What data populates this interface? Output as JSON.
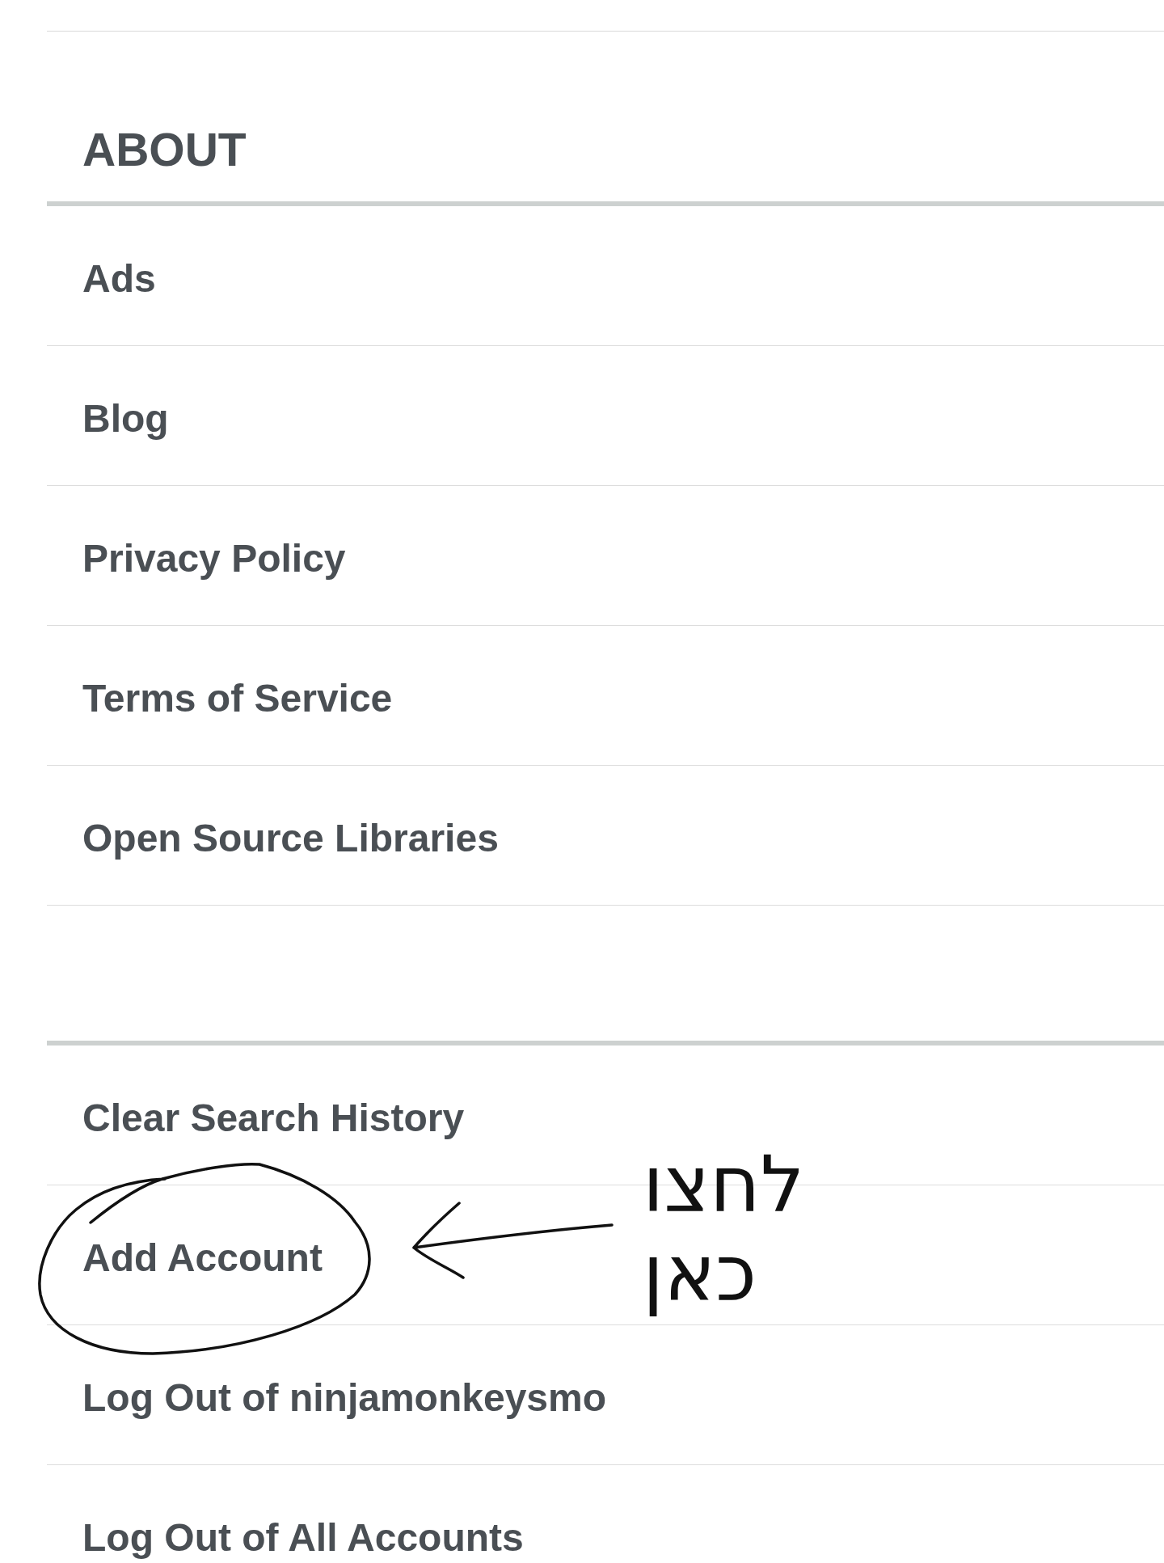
{
  "sections": [
    {
      "heading": "ABOUT",
      "items": [
        {
          "label": "Ads",
          "circled": false
        },
        {
          "label": "Blog",
          "circled": false
        },
        {
          "label": "Privacy Policy",
          "circled": false
        },
        {
          "label": "Terms of Service",
          "circled": false
        },
        {
          "label": "Open Source Libraries",
          "circled": false
        }
      ]
    },
    {
      "items": [
        {
          "label": "Clear Search History",
          "circled": false
        },
        {
          "label": "Add Account",
          "circled": true,
          "note": "לחצו כאן"
        },
        {
          "label": "Log Out of ninjamonkeysmo",
          "circled": false
        },
        {
          "label": "Log Out of All Accounts",
          "circled": false
        }
      ]
    }
  ]
}
